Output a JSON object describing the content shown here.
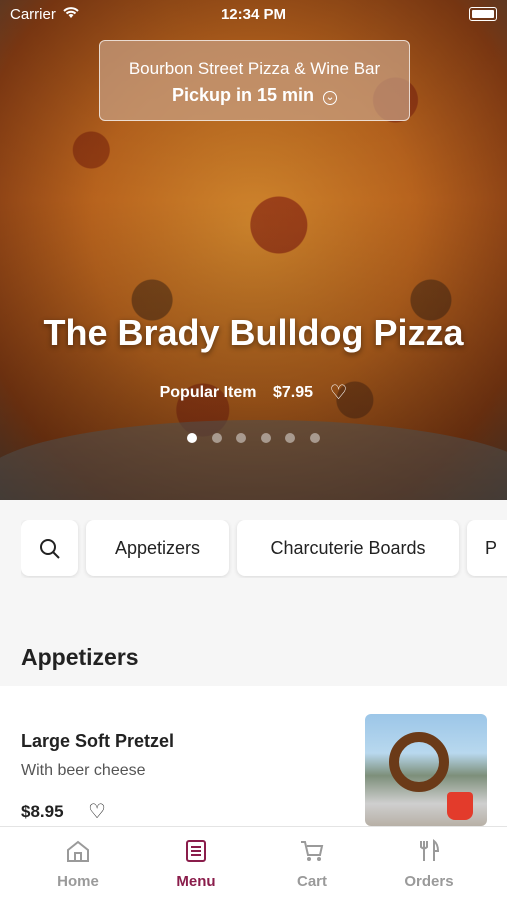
{
  "status": {
    "carrier": "Carrier",
    "time": "12:34 PM"
  },
  "store": {
    "name": "Bourbon Street Pizza & Wine Bar",
    "pickup": "Pickup in 15 min"
  },
  "hero": {
    "title": "The Brady Bulldog Pizza",
    "tag": "Popular Item",
    "price": "$7.95",
    "slides": 6,
    "active_slide": 1
  },
  "categories": [
    "Appetizers",
    "Charcuterie Boards",
    "P"
  ],
  "section": {
    "title": "Appetizers"
  },
  "item": {
    "name": "Large Soft Pretzel",
    "desc": "With beer cheese",
    "price": "$8.95"
  },
  "tabs": [
    {
      "label": "Home",
      "icon": "home-icon"
    },
    {
      "label": "Menu",
      "icon": "menu-icon"
    },
    {
      "label": "Cart",
      "icon": "cart-icon"
    },
    {
      "label": "Orders",
      "icon": "orders-icon"
    }
  ],
  "colors": {
    "accent": "#8a1d4b",
    "tab_inactive": "#9a9a9a"
  }
}
